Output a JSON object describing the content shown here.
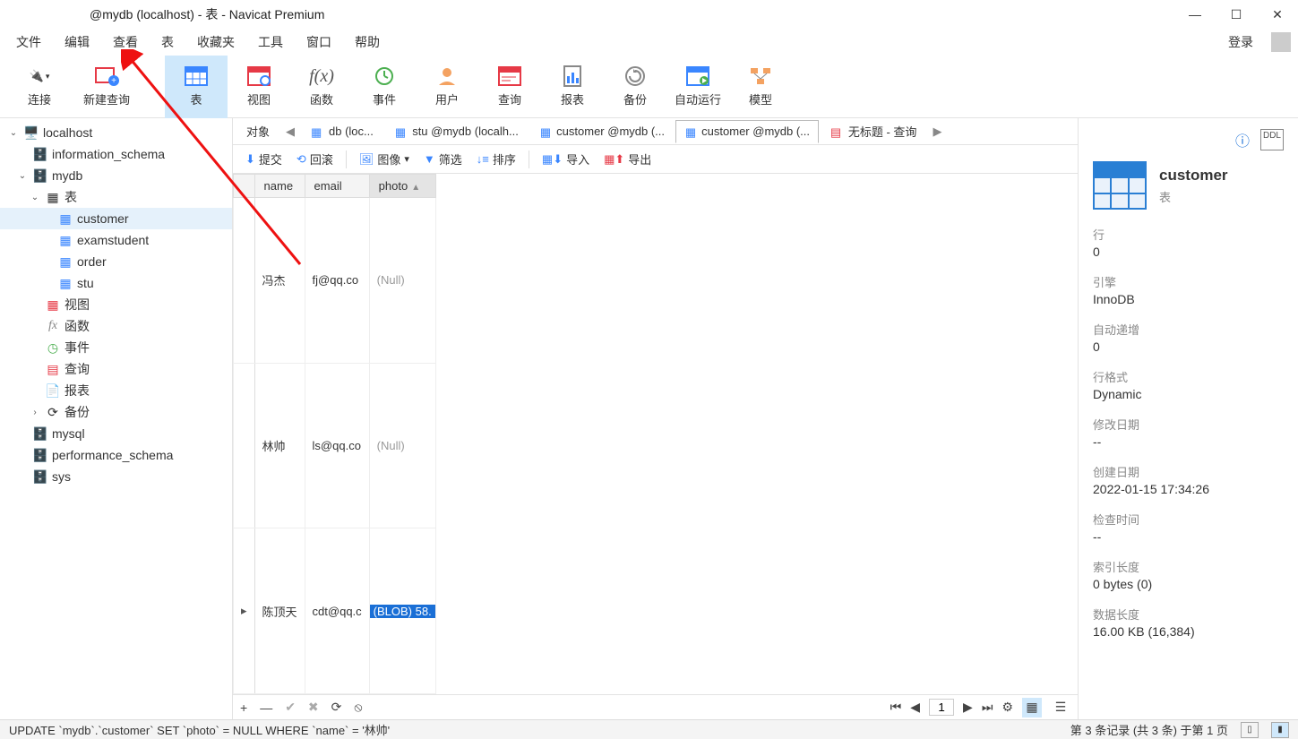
{
  "window": {
    "title": "@mydb (localhost) - 表 - Navicat Premium"
  },
  "menu": {
    "file": "文件",
    "edit": "编辑",
    "view": "查看",
    "table": "表",
    "favorites": "收藏夹",
    "tools": "工具",
    "window": "窗口",
    "help": "帮助",
    "login": "登录"
  },
  "toolbar_main": {
    "connect": "连接",
    "newquery": "新建查询",
    "table": "表",
    "view": "视图",
    "function": "函数",
    "event": "事件",
    "user": "用户",
    "query": "查询",
    "report": "报表",
    "backup": "备份",
    "autorun": "自动运行",
    "model": "模型"
  },
  "sidebar": {
    "host": "localhost",
    "dbs": {
      "info": "information_schema",
      "mydb": "mydb",
      "mysql": "mysql",
      "perf": "performance_schema",
      "sys": "sys"
    },
    "nodes": {
      "tables": "表",
      "views": "视图",
      "functions": "函数",
      "events": "事件",
      "queries": "查询",
      "reports": "报表",
      "backups": "备份"
    },
    "mydb_tables": {
      "customer": "customer",
      "examstudent": "examstudent",
      "order": "order",
      "stu": "stu"
    }
  },
  "tabs": {
    "objects": "对象",
    "t1": "db (loc...",
    "t2": "stu @mydb (localh...",
    "t3": "customer @mydb (...",
    "t4": "customer @mydb (...",
    "t5": "无标题 - 查询"
  },
  "subtool": {
    "commit": "提交",
    "rollback": "回滚",
    "image": "图像",
    "filter": "筛选",
    "sort": "排序",
    "import": "导入",
    "export": "导出"
  },
  "grid": {
    "columns": {
      "name": "name",
      "email": "email",
      "photo": "photo"
    },
    "rows": [
      {
        "name": "冯杰",
        "email": "fj@qq.co",
        "photo_null": true,
        "photo_text": "(Null)"
      },
      {
        "name": "林帅",
        "email": "ls@qq.co",
        "photo_null": true,
        "photo_text": "(Null)"
      },
      {
        "name": "陈顶天",
        "email": "cdt@qq.c",
        "photo_null": false,
        "photo_text": "(BLOB) 58."
      }
    ]
  },
  "pager": {
    "page": "1"
  },
  "info": {
    "title": "customer",
    "subtitle": "表",
    "rows_label": "行",
    "rows_val": "0",
    "engine_label": "引擎",
    "engine_val": "InnoDB",
    "ai_label": "自动递增",
    "ai_val": "0",
    "rowfmt_label": "行格式",
    "rowfmt_val": "Dynamic",
    "mod_label": "修改日期",
    "mod_val": "--",
    "create_label": "创建日期",
    "create_val": "2022-01-15 17:34:26",
    "check_label": "检查时间",
    "check_val": "--",
    "idx_label": "索引长度",
    "idx_val": "0 bytes (0)",
    "data_label": "数据长度",
    "data_val": "16.00 KB (16,384)"
  },
  "status": {
    "sql": "UPDATE `mydb`.`customer` SET `photo` = NULL WHERE `name` = '林帅'",
    "record": "第 3 条记录 (共 3 条) 于第 1 页"
  }
}
